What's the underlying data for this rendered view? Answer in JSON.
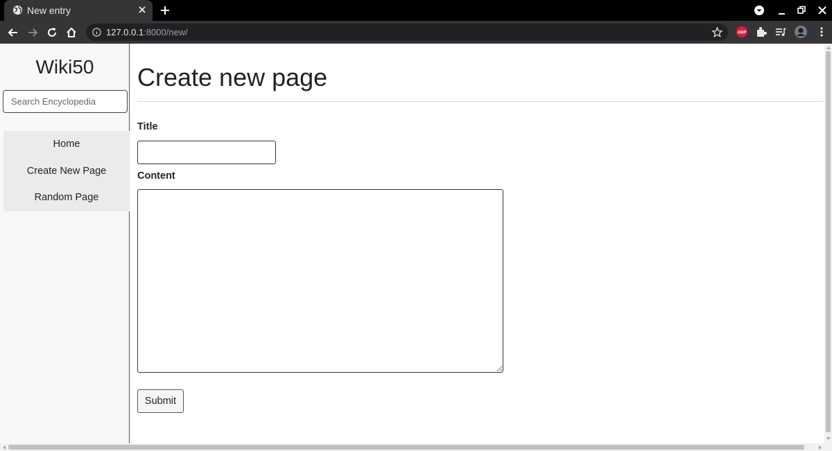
{
  "browser": {
    "tab_title": "New entry",
    "url_host": "127.0.0.1",
    "url_rest": ":8000/new/"
  },
  "sidebar": {
    "logo": "Wiki50",
    "search_placeholder": "Search Encyclopedia",
    "nav": [
      {
        "label": "Home"
      },
      {
        "label": "Create New Page"
      },
      {
        "label": "Random Page"
      }
    ]
  },
  "main": {
    "heading": "Create new page",
    "title_label": "Title",
    "title_value": "",
    "content_label": "Content",
    "content_value": "",
    "submit_label": "Submit"
  },
  "icons": {
    "extension_abp": "ABP"
  }
}
